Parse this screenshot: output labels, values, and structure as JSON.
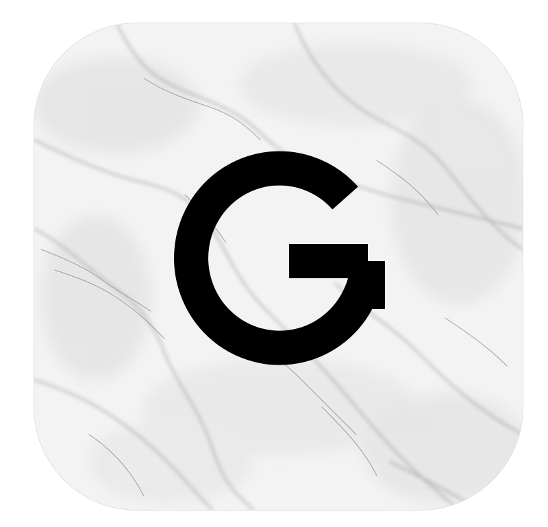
{
  "app_icon": {
    "letter": "G",
    "letter_color": "#000000",
    "background": "white-marble-texture",
    "marble_base_color": "#f3f3f3",
    "vein_color": "#9a958f",
    "border_color": "#dcdcdc"
  }
}
